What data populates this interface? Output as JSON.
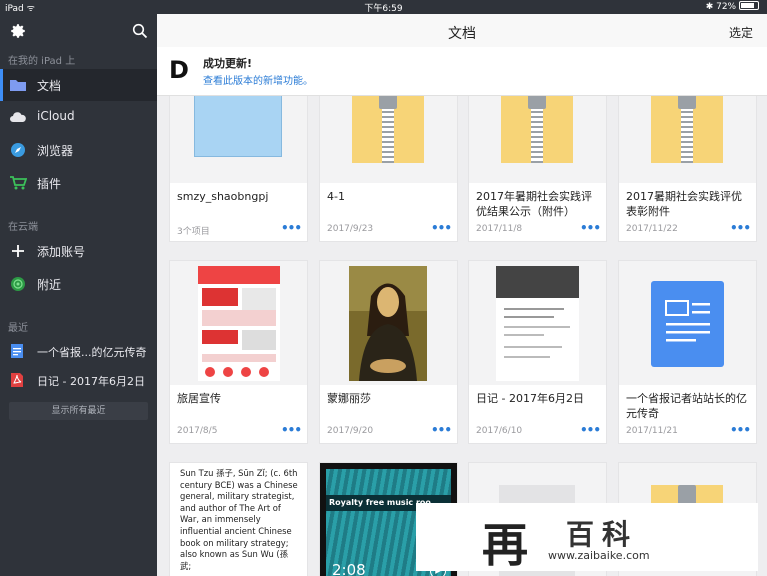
{
  "status": {
    "carrier": "iPad",
    "time": "下午6:59",
    "battery": "72%"
  },
  "sidebar": {
    "section_local": "在我的 iPad 上",
    "items_local": [
      {
        "label": "文档",
        "icon": "folder-icon",
        "active": true
      },
      {
        "label": "iCloud",
        "icon": "cloud-icon"
      },
      {
        "label": "浏览器",
        "icon": "compass-icon"
      },
      {
        "label": "插件",
        "icon": "cart-icon"
      }
    ],
    "section_cloud": "在云端",
    "items_cloud": [
      {
        "label": "添加账号",
        "icon": "plus-icon"
      },
      {
        "label": "附近",
        "icon": "nearby-icon"
      }
    ],
    "section_recent": "最近",
    "recent": [
      {
        "label": "一个省报...的亿元传奇",
        "icon": "doc-icon"
      },
      {
        "label": "日记 - 2017年6月2日",
        "icon": "pdf-icon"
      }
    ],
    "show_all": "显示所有最近"
  },
  "header": {
    "title": "文档",
    "select": "选定"
  },
  "banner": {
    "logo": "D",
    "title": "成功更新!",
    "link": "查看此版本的新增功能。"
  },
  "files": [
    {
      "name": "smzy_shaobngpj",
      "date": "3个项目",
      "kind": "folder"
    },
    {
      "name": "4-1",
      "date": "2017/9/23",
      "kind": "zip"
    },
    {
      "name": "2017年暑期社会实践评优结果公示（附件）",
      "date": "2017/11/8",
      "kind": "zip"
    },
    {
      "name": "2017暑期社会实践评优表彰附件",
      "date": "2017/11/22",
      "kind": "zip"
    },
    {
      "name": "旅居宣传",
      "date": "2017/8/5",
      "kind": "poster"
    },
    {
      "name": "蒙娜丽莎",
      "date": "2017/9/20",
      "kind": "painting"
    },
    {
      "name": "日记 - 2017年6月2日",
      "date": "2017/6/10",
      "kind": "page"
    },
    {
      "name": "一个省报记者站站长的亿元传奇",
      "date": "2017/11/21",
      "kind": "gdoc"
    }
  ],
  "more_label": "•••",
  "partial": {
    "text_doc": "Sun Tzu 孫子, Sūn Zǐ; (c. 6th century BCE) was a Chinese general, military strategist, and author of The Art of War, an immensely influential ancient Chinese book on military strategy; also known as Sun Wu (孫武;",
    "video_title": "Royalty free music roo",
    "video_duration": "2:08"
  },
  "watermark": {
    "big": "再",
    "big2": "百科",
    "url": "www.zaibaike.com"
  },
  "colors": {
    "sidebar": "#2f333a",
    "accent": "#3e8ef7",
    "zip": "#f7d477",
    "folder": "#a9d4f3"
  }
}
